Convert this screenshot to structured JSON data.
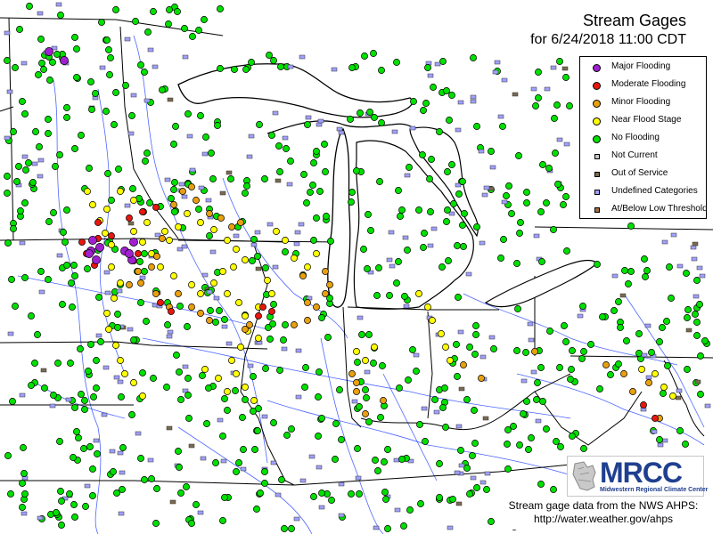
{
  "title": {
    "line1": "Stream Gages",
    "line2": "for 6/24/2018 11:00 CDT"
  },
  "legend": {
    "items": [
      {
        "label": "Major Flooding",
        "shape": "circle",
        "color": "#a020d0"
      },
      {
        "label": "Moderate Flooding",
        "shape": "circle",
        "color": "#e8170f"
      },
      {
        "label": "Minor Flooding",
        "shape": "circle",
        "color": "#e8a010"
      },
      {
        "label": "Near Flood Stage",
        "shape": "circle",
        "color": "#ffff00"
      },
      {
        "label": "No Flooding",
        "shape": "circle",
        "color": "#00e000"
      },
      {
        "label": "Not Current",
        "shape": "square",
        "color": "#c8c8c8"
      },
      {
        "label": "Out of Service",
        "shape": "square",
        "color": "#7a6a50"
      },
      {
        "label": "Undefined Categories",
        "shape": "square",
        "color": "#a0a0ff"
      },
      {
        "label": "At/Below Low Threshold",
        "shape": "square",
        "color": "#a07040"
      }
    ]
  },
  "logo": {
    "text": "MRCC",
    "subtitle": "Midwestern Regional Climate Center"
  },
  "credit": {
    "line1": "Stream gage data from the NWS AHPS:",
    "line2": "http://water.weather.gov/ahps"
  },
  "colors": {
    "land": "#ffffff",
    "lake": "#ffffff",
    "state_border": "#000000",
    "river": "#2040ff",
    "no_flooding": "#00e000",
    "near_flood": "#ffff00",
    "minor": "#e8a010",
    "moderate": "#e8170f",
    "major": "#a020d0",
    "undefined": "#a0a0ff",
    "out_of_service": "#7a6a50"
  }
}
